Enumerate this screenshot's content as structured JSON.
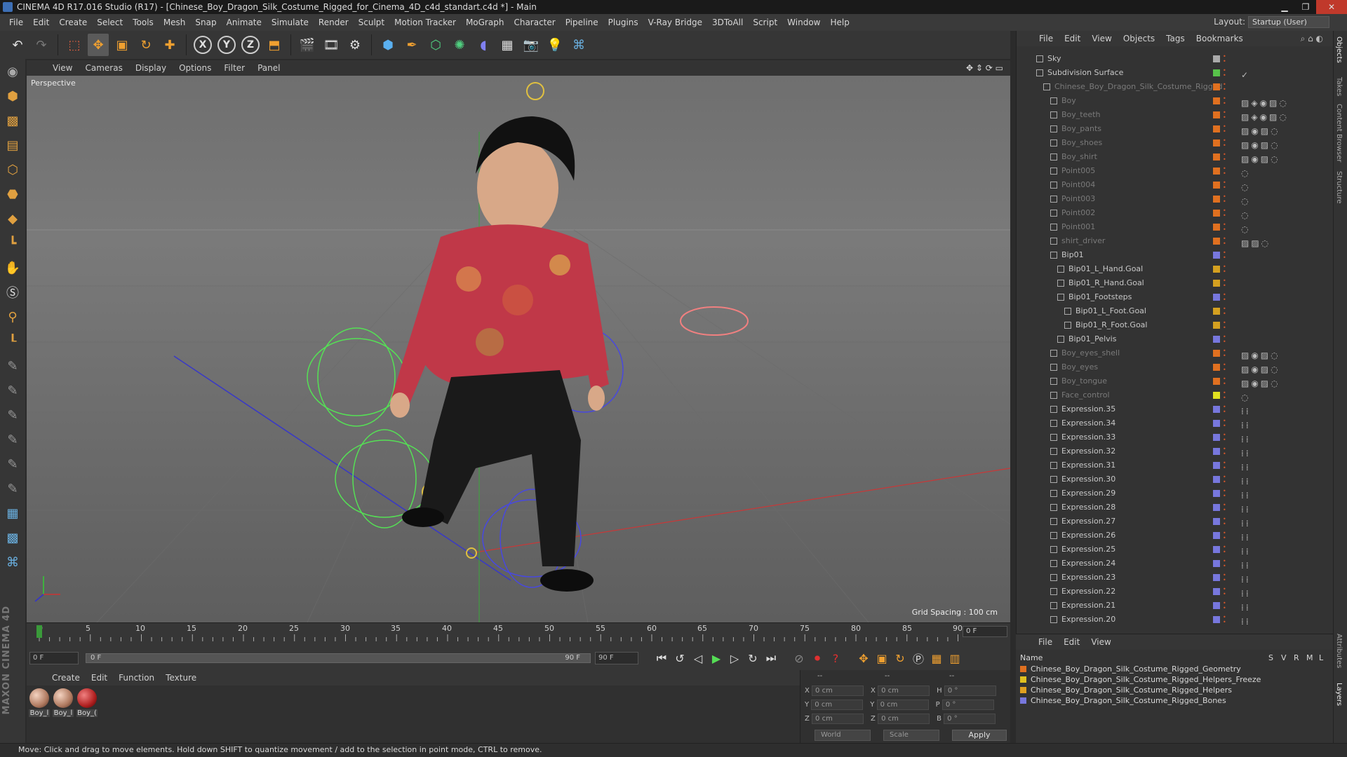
{
  "window": {
    "title": "CINEMA 4D R17.016 Studio (R17) - [Chinese_Boy_Dragon_Silk_Costume_Rigged_for_Cinema_4D_c4d_standart.c4d *] - Main"
  },
  "menubar": {
    "items": [
      "File",
      "Edit",
      "Create",
      "Select",
      "Tools",
      "Mesh",
      "Snap",
      "Animate",
      "Simulate",
      "Render",
      "Sculpt",
      "Motion Tracker",
      "MoGraph",
      "Character",
      "Pipeline",
      "Plugins",
      "V-Ray Bridge",
      "3DToAll",
      "Script",
      "Window",
      "Help"
    ],
    "layout_label": "Layout:",
    "layout_value": "Startup (User)"
  },
  "toolbar": {
    "icons": [
      "undo-icon",
      "redo-icon",
      "live-select-icon",
      "move-icon",
      "scale-icon",
      "rotate-icon",
      "transform-icon",
      "x-axis-icon",
      "y-axis-icon",
      "z-axis-icon",
      "coord-system-icon",
      "render-view-icon",
      "render-picture-viewer-icon",
      "render-settings-icon",
      "cube-icon",
      "pen-icon",
      "subdivision-icon",
      "array-icon",
      "deformer-icon",
      "floor-icon",
      "camera-icon",
      "light-icon",
      "python-icon"
    ],
    "axis_labels": [
      "X",
      "Y",
      "Z"
    ]
  },
  "viewport": {
    "menu": [
      "View",
      "Cameras",
      "Display",
      "Options",
      "Filter",
      "Panel"
    ],
    "label": "Perspective",
    "grid_spacing": "Grid Spacing : 100 cm"
  },
  "timeline": {
    "ticks": [
      "0",
      "5",
      "10",
      "15",
      "20",
      "25",
      "30",
      "35",
      "40",
      "45",
      "50",
      "55",
      "60",
      "65",
      "70",
      "75",
      "80",
      "85",
      "90"
    ],
    "current_frame": "0 F"
  },
  "transport": {
    "start_field": "0 F",
    "range_start": "0 F",
    "range_end": "90 F",
    "end_field": "90 F"
  },
  "materials": {
    "menu": [
      "Create",
      "Edit",
      "Function",
      "Texture"
    ],
    "items": [
      {
        "label": "Boy_l"
      },
      {
        "label": "Boy_l"
      },
      {
        "label": "Boy_("
      }
    ]
  },
  "coords": {
    "header_a": "--",
    "header_b": "--",
    "header_c": "--",
    "rows": [
      {
        "axis": "X",
        "pos": "0 cm",
        "axis2": "X",
        "size": "0 cm",
        "rl": "H",
        "rot": "0 °"
      },
      {
        "axis": "Y",
        "pos": "0 cm",
        "axis2": "Y",
        "size": "0 cm",
        "rl": "P",
        "rot": "0 °"
      },
      {
        "axis": "Z",
        "pos": "0 cm",
        "axis2": "Z",
        "size": "0 cm",
        "rl": "B",
        "rot": "0 °"
      }
    ],
    "mode": "World",
    "type": "Scale",
    "apply": "Apply"
  },
  "status": {
    "text": "Move: Click and drag to move elements. Hold down SHIFT to quantize movement / add to the selection in point mode, CTRL to remove."
  },
  "objects": {
    "menu": [
      "File",
      "Edit",
      "View",
      "Objects",
      "Tags",
      "Bookmarks"
    ],
    "rows": [
      {
        "name": "Sky",
        "indent": 0,
        "color": "#aaaaaa",
        "dim": false,
        "tags": ""
      },
      {
        "name": "Subdivision Surface",
        "indent": 0,
        "color": "#58c24a",
        "dim": false,
        "tags": "✓"
      },
      {
        "name": "Chinese_Boy_Dragon_Silk_Costume_Rigged",
        "indent": 1,
        "color": "#e07020",
        "dim": true,
        "tags": ""
      },
      {
        "name": "Boy",
        "indent": 2,
        "color": "#e07020",
        "dim": true,
        "tags": "▨◈◉▨◌"
      },
      {
        "name": "Boy_teeth",
        "indent": 2,
        "color": "#e07020",
        "dim": true,
        "tags": "▨◈◉▨◌"
      },
      {
        "name": "Boy_pants",
        "indent": 2,
        "color": "#e07020",
        "dim": true,
        "tags": "▨◉▨◌"
      },
      {
        "name": "Boy_shoes",
        "indent": 2,
        "color": "#e07020",
        "dim": true,
        "tags": "▨◉▨◌"
      },
      {
        "name": "Boy_shirt",
        "indent": 2,
        "color": "#e07020",
        "dim": true,
        "tags": "▨◉▨◌"
      },
      {
        "name": "Point005",
        "indent": 2,
        "color": "#e07020",
        "dim": true,
        "tags": "◌"
      },
      {
        "name": "Point004",
        "indent": 2,
        "color": "#e07020",
        "dim": true,
        "tags": "◌"
      },
      {
        "name": "Point003",
        "indent": 2,
        "color": "#e07020",
        "dim": true,
        "tags": "◌"
      },
      {
        "name": "Point002",
        "indent": 2,
        "color": "#e07020",
        "dim": true,
        "tags": "◌"
      },
      {
        "name": "Point001",
        "indent": 2,
        "color": "#e07020",
        "dim": true,
        "tags": "◌"
      },
      {
        "name": "shirt_driver",
        "indent": 2,
        "color": "#e07020",
        "dim": true,
        "tags": "▨▨◌"
      },
      {
        "name": "Bip01",
        "indent": 2,
        "color": "#7777dd",
        "dim": false,
        "tags": ""
      },
      {
        "name": "Bip01_L_Hand.Goal",
        "indent": 3,
        "color": "#d4a020",
        "dim": false,
        "tags": ""
      },
      {
        "name": "Bip01_R_Hand.Goal",
        "indent": 3,
        "color": "#d4a020",
        "dim": false,
        "tags": ""
      },
      {
        "name": "Bip01_Footsteps",
        "indent": 3,
        "color": "#7777dd",
        "dim": false,
        "tags": ""
      },
      {
        "name": "Bip01_L_Foot.Goal",
        "indent": 4,
        "color": "#d4a020",
        "dim": false,
        "tags": ""
      },
      {
        "name": "Bip01_R_Foot.Goal",
        "indent": 4,
        "color": "#d4a020",
        "dim": false,
        "tags": ""
      },
      {
        "name": "Bip01_Pelvis",
        "indent": 3,
        "color": "#7777dd",
        "dim": false,
        "tags": ""
      },
      {
        "name": "Boy_eyes_shell",
        "indent": 2,
        "color": "#e07020",
        "dim": true,
        "tags": "▨◉▨◌"
      },
      {
        "name": "Boy_eyes",
        "indent": 2,
        "color": "#e07020",
        "dim": true,
        "tags": "▨◉▨◌"
      },
      {
        "name": "Boy_tongue",
        "indent": 2,
        "color": "#e07020",
        "dim": true,
        "tags": "▨◉▨◌"
      },
      {
        "name": "Face_control",
        "indent": 2,
        "color": "#e0e020",
        "dim": true,
        "tags": "◌"
      },
      {
        "name": "Expression.35",
        "indent": 2,
        "color": "#7777dd",
        "dim": false,
        "tags": "⁞⁞"
      },
      {
        "name": "Expression.34",
        "indent": 2,
        "color": "#7777dd",
        "dim": false,
        "tags": "⁞⁞"
      },
      {
        "name": "Expression.33",
        "indent": 2,
        "color": "#7777dd",
        "dim": false,
        "tags": "⁞⁞"
      },
      {
        "name": "Expression.32",
        "indent": 2,
        "color": "#7777dd",
        "dim": false,
        "tags": "⁞⁞"
      },
      {
        "name": "Expression.31",
        "indent": 2,
        "color": "#7777dd",
        "dim": false,
        "tags": "⁞⁞"
      },
      {
        "name": "Expression.30",
        "indent": 2,
        "color": "#7777dd",
        "dim": false,
        "tags": "⁞⁞"
      },
      {
        "name": "Expression.29",
        "indent": 2,
        "color": "#7777dd",
        "dim": false,
        "tags": "⁞⁞"
      },
      {
        "name": "Expression.28",
        "indent": 2,
        "color": "#7777dd",
        "dim": false,
        "tags": "⁞⁞"
      },
      {
        "name": "Expression.27",
        "indent": 2,
        "color": "#7777dd",
        "dim": false,
        "tags": "⁞⁞"
      },
      {
        "name": "Expression.26",
        "indent": 2,
        "color": "#7777dd",
        "dim": false,
        "tags": "⁞⁞"
      },
      {
        "name": "Expression.25",
        "indent": 2,
        "color": "#7777dd",
        "dim": false,
        "tags": "⁞⁞"
      },
      {
        "name": "Expression.24",
        "indent": 2,
        "color": "#7777dd",
        "dim": false,
        "tags": "⁞⁞"
      },
      {
        "name": "Expression.23",
        "indent": 2,
        "color": "#7777dd",
        "dim": false,
        "tags": "⁞⁞"
      },
      {
        "name": "Expression.22",
        "indent": 2,
        "color": "#7777dd",
        "dim": false,
        "tags": "⁞⁞"
      },
      {
        "name": "Expression.21",
        "indent": 2,
        "color": "#7777dd",
        "dim": false,
        "tags": "⁞⁞"
      },
      {
        "name": "Expression.20",
        "indent": 2,
        "color": "#7777dd",
        "dim": false,
        "tags": "⁞⁞"
      }
    ]
  },
  "layers": {
    "menu": [
      "File",
      "Edit",
      "View"
    ],
    "name_header": "Name",
    "cols": [
      "S",
      "V",
      "R",
      "M",
      "L"
    ],
    "rows": [
      {
        "name": "Chinese_Boy_Dragon_Silk_Costume_Rigged_Geometry",
        "color": "#e07020"
      },
      {
        "name": "Chinese_Boy_Dragon_Silk_Costume_Rigged_Helpers_Freeze",
        "color": "#e0c020"
      },
      {
        "name": "Chinese_Boy_Dragon_Silk_Costume_Rigged_Helpers",
        "color": "#e0a020"
      },
      {
        "name": "Chinese_Boy_Dragon_Silk_Costume_Rigged_Bones",
        "color": "#7777dd"
      }
    ]
  },
  "sidetabs": [
    "Objects",
    "Takes",
    "Content Browser",
    "Structure",
    "Attributes",
    "Layers"
  ]
}
